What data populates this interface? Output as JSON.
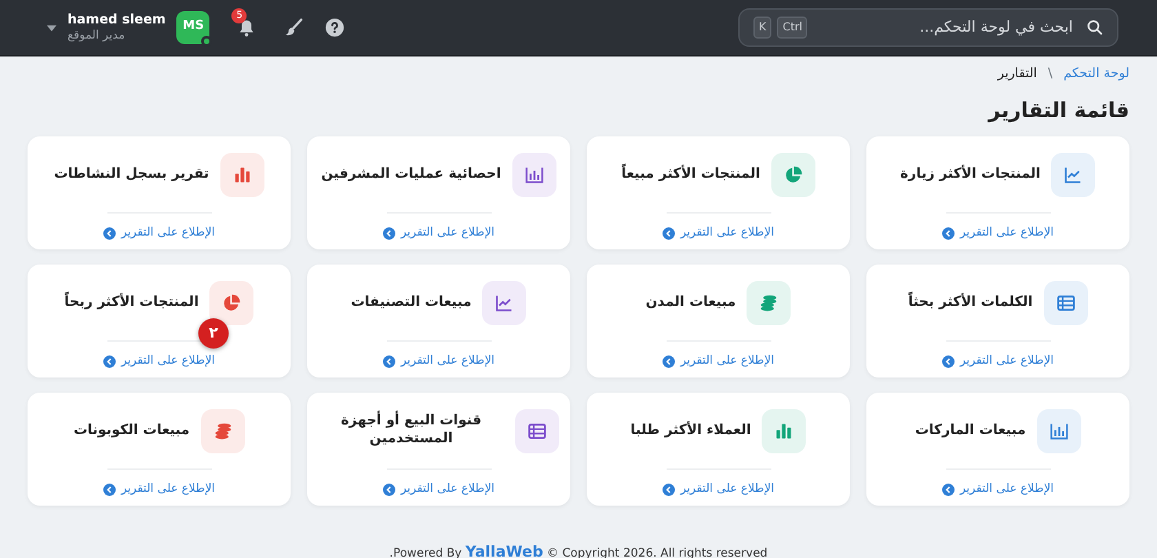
{
  "header": {
    "search": {
      "placeholder": "ابحث في لوحة التحكم...",
      "keys": [
        "Ctrl",
        "K"
      ]
    },
    "notifications": {
      "count": "5"
    },
    "user": {
      "initials": "MS",
      "online": true,
      "name": "hamed sleem",
      "role": "مدير الموقع"
    }
  },
  "breadcrumb": [
    {
      "label": "لوحة التحكم"
    },
    {
      "label": "التقارير"
    }
  ],
  "breadcrumb_separator": "\\",
  "page_title": "قائمة التقارير",
  "reports": [
    {
      "title": "المنتجات الأكثر زيارة",
      "kind": "line",
      "color": "#2f7fd6",
      "link": "الإطلاع على التقرير"
    },
    {
      "title": "المنتجات الأكثر مبيعاً",
      "kind": "pie",
      "color": "#13a57a",
      "link": "الإطلاع على التقرير"
    },
    {
      "title": "احصائية عمليات المشرفين",
      "kind": "framed-bars",
      "color": "#7c4dcc",
      "link": "الإطلاع على التقرير"
    },
    {
      "title": "تقرير بسجل النشاطات",
      "kind": "bars",
      "color": "#e5483b",
      "link": "الإطلاع على التقرير"
    },
    {
      "title": "الكلمات الأكثر بحثاً",
      "kind": "table",
      "color": "#2f7fd6",
      "link": "الإطلاع على التقرير"
    },
    {
      "title": "مبيعات المدن",
      "kind": "coins",
      "color": "#13a57a",
      "link": "الإطلاع على التقرير"
    },
    {
      "title": "مبيعات التصنيفات",
      "kind": "line",
      "color": "#7c4dcc",
      "link": "الإطلاع على التقرير"
    },
    {
      "title": "المنتجات الأكثر ربحاً",
      "kind": "pie",
      "color": "#e5483b",
      "link": "الإطلاع على التقرير",
      "badge": "٢"
    },
    {
      "title": "مبيعات الماركات",
      "kind": "framed-bars",
      "color": "#2f7fd6",
      "link": "الإطلاع على التقرير"
    },
    {
      "title": "العملاء الأكثر طلبا",
      "kind": "bars",
      "color": "#13a57a",
      "link": "الإطلاع على التقرير"
    },
    {
      "title": "قنوات البيع أو أجهزة المستخدمين",
      "kind": "table",
      "color": "#7c4dcc",
      "link": "الإطلاع على التقرير"
    },
    {
      "title": "مبيعات الكوبونات",
      "kind": "coins",
      "color": "#e5483b",
      "link": "الإطلاع على التقرير"
    }
  ],
  "footer": {
    "prefix": "Powered By",
    "brand": "YallaWeb",
    "suffix": "© Copyright 2026. All rights reserved",
    "end_mark": "."
  }
}
